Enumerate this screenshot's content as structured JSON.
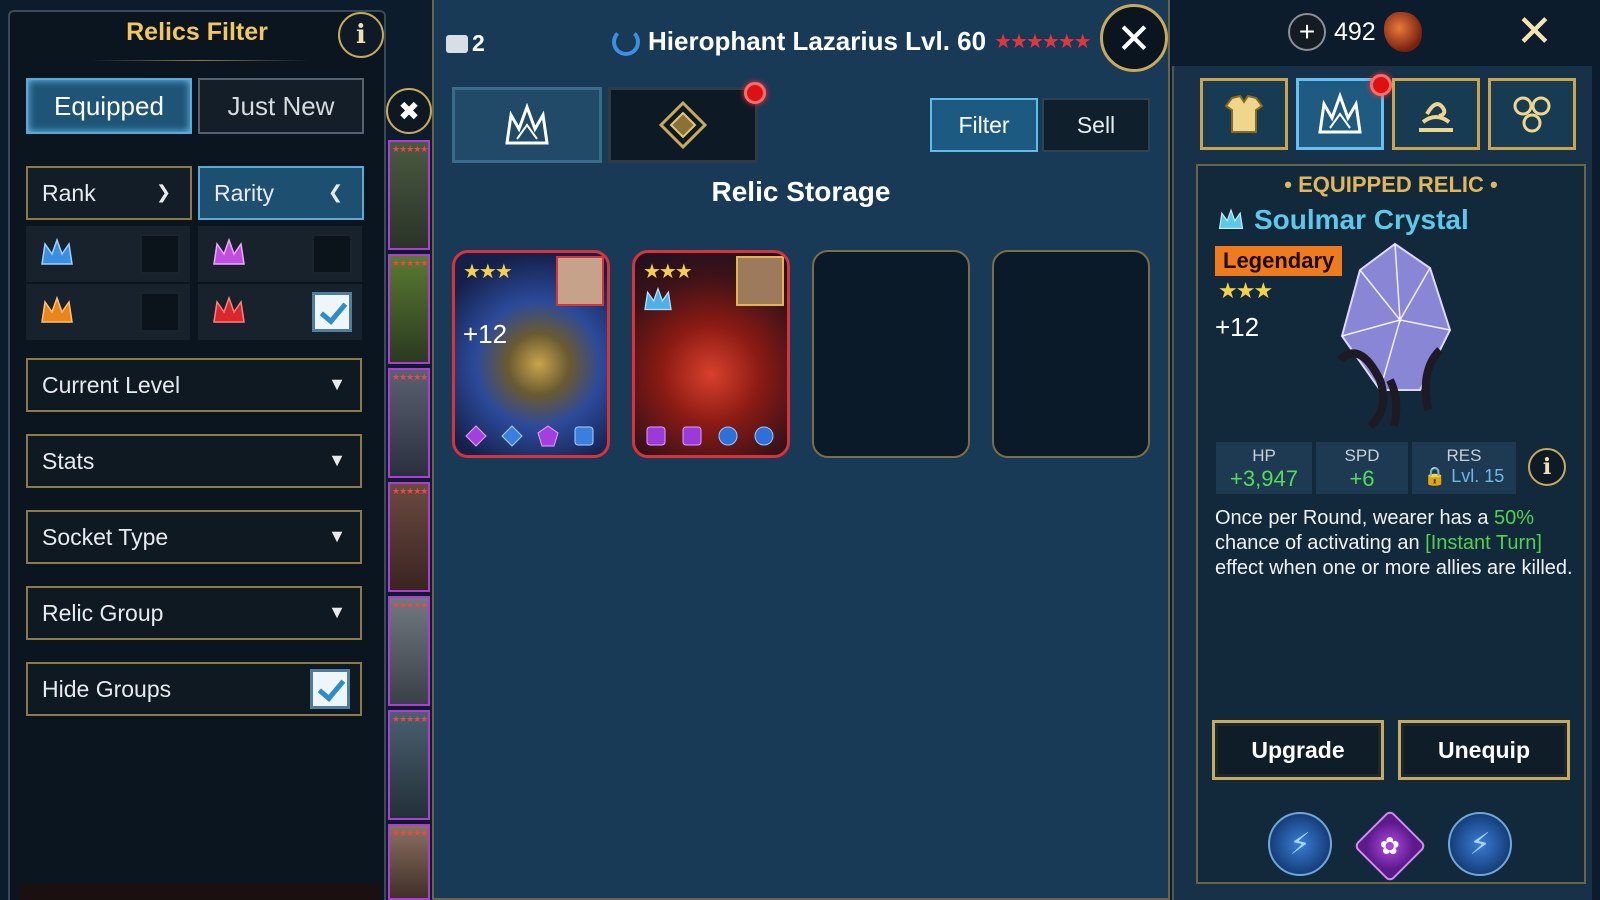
{
  "filter": {
    "title": "Relics Filter",
    "tabs": [
      "Equipped",
      "Just New"
    ],
    "rank_label": "Rank",
    "rarity_label": "Rarity",
    "dropdowns": [
      "Current Level",
      "Stats",
      "Socket Type",
      "Relic Group"
    ],
    "hide_groups_label": "Hide Groups",
    "hide_groups_checked": true,
    "rarity_options": [
      {
        "icon": "blue-crown-icon",
        "color": "#3c8fe0",
        "checked": false
      },
      {
        "icon": "purple-crown-icon",
        "color": "#c04fe0",
        "checked": false
      },
      {
        "icon": "orange-crown-icon",
        "color": "#e8861c",
        "checked": false
      },
      {
        "icon": "red-crown-icon",
        "color": "#d8282c",
        "checked": true
      }
    ]
  },
  "header": {
    "hero_count": "2",
    "hero_name": "Hierophant Lazarius Lvl. 60",
    "rank_stars": "★★★★★★",
    "currency_value": "492"
  },
  "storage": {
    "title": "Relic Storage",
    "filter_label": "Filter",
    "sell_label": "Sell",
    "cards": [
      {
        "stars": "★★★",
        "level": "+12"
      },
      {
        "stars": "★★★",
        "level": ""
      }
    ]
  },
  "equipped": {
    "section_title": "• EQUIPPED RELIC •",
    "name": "Soulmar Crystal",
    "rarity": "Legendary",
    "stars": "★★★",
    "level": "+12",
    "stats": [
      {
        "label": "HP",
        "value": "+3,947"
      },
      {
        "label": "SPD",
        "value": "+6"
      },
      {
        "label": "RES",
        "value": "Lvl. 15"
      }
    ],
    "description": {
      "p1": "Once per Round, wearer has a ",
      "pct": "50%",
      "p2": " chance of activating an ",
      "effect": "[Instant Turn]",
      "p3": " effect when one or more allies are killed."
    },
    "upgrade_label": "Upgrade",
    "unequip_label": "Unequip"
  },
  "colors": {
    "gold": "#c9a95a",
    "legendary": "#f07b1d",
    "stat_green": "#55dd55",
    "accent_blue": "#5ec8ea"
  }
}
